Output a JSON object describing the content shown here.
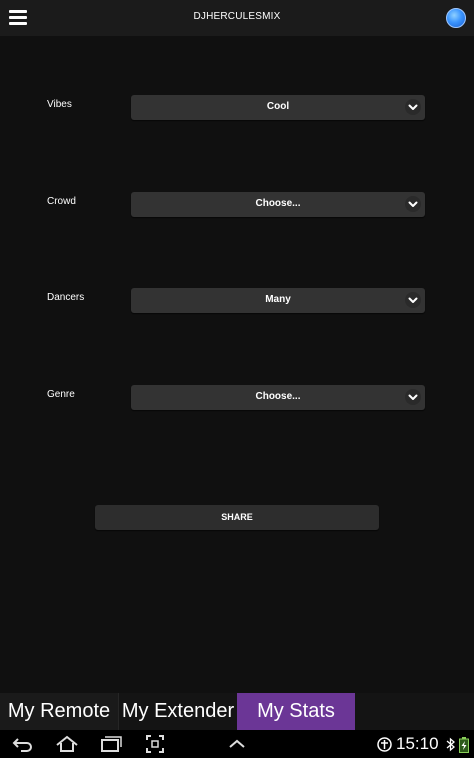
{
  "header": {
    "title": "DJHERCULESMIX",
    "menu_icon": "hamburger-icon",
    "status_icon": "connection-status-dot"
  },
  "form": {
    "fields": [
      {
        "label": "Vibes",
        "value": "Cool"
      },
      {
        "label": "Crowd",
        "value": "Choose..."
      },
      {
        "label": "Dancers",
        "value": "Many"
      },
      {
        "label": "Genre",
        "value": "Choose..."
      }
    ],
    "share_label": "SHARE"
  },
  "tabs": [
    {
      "label": "My Remote",
      "active": false
    },
    {
      "label": "My Extender",
      "active": false
    },
    {
      "label": "My Stats",
      "active": true
    }
  ],
  "colors": {
    "background": "#101010",
    "select_bg": "#333333",
    "active_tab": "#6b3696",
    "status_dot": "#3b95ff"
  },
  "system_bar": {
    "time": "15:10",
    "icons": [
      "back-icon",
      "home-icon",
      "recent-apps-icon",
      "screenshot-icon",
      "chevron-up-icon",
      "accessibility-icon",
      "bluetooth-icon",
      "battery-charging-icon"
    ]
  }
}
